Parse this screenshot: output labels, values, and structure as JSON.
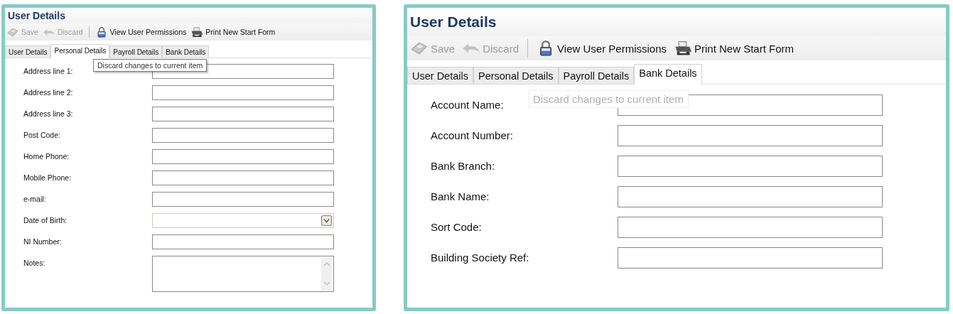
{
  "panels": [
    {
      "title": "User Details",
      "toolbar": [
        {
          "kind": "save",
          "label": "Save",
          "disabled": true
        },
        {
          "kind": "discard",
          "label": "Discard",
          "disabled": true
        },
        {
          "kind": "separator"
        },
        {
          "kind": "permissions",
          "label": "View User Permissions",
          "disabled": false
        },
        {
          "kind": "print",
          "label": "Print New Start Form",
          "disabled": false
        }
      ],
      "tabs": [
        {
          "label": "User Details",
          "selected": false
        },
        {
          "label": "Personal Details",
          "selected": true
        },
        {
          "label": "Payroll Details",
          "selected": false
        },
        {
          "label": "Bank Details",
          "selected": false
        }
      ],
      "tooltip": {
        "text": "Discard changes to current item",
        "faded": false
      },
      "fields": [
        {
          "label": "Address line 1:",
          "kind": "text"
        },
        {
          "label": "Address line 2:",
          "kind": "text"
        },
        {
          "label": "Address line 3:",
          "kind": "text"
        },
        {
          "label": "Post Code:",
          "kind": "text"
        },
        {
          "label": "Home Phone:",
          "kind": "text"
        },
        {
          "label": "Mobile Phone:",
          "kind": "text"
        },
        {
          "label": "e-mail:",
          "kind": "text"
        },
        {
          "label": "Date of Birth:",
          "kind": "date"
        },
        {
          "label": "NI Number:",
          "kind": "text"
        },
        {
          "label": "Notes:",
          "kind": "textarea"
        }
      ]
    },
    {
      "title": "User Details",
      "toolbar": [
        {
          "kind": "save",
          "label": "Save",
          "disabled": true
        },
        {
          "kind": "discard",
          "label": "Discard",
          "disabled": true
        },
        {
          "kind": "separator"
        },
        {
          "kind": "permissions",
          "label": "View User Permissions",
          "disabled": false
        },
        {
          "kind": "print",
          "label": "Print New Start Form",
          "disabled": false
        }
      ],
      "tabs": [
        {
          "label": "User Details",
          "selected": false
        },
        {
          "label": "Personal Details",
          "selected": false
        },
        {
          "label": "Payroll Details",
          "selected": false
        },
        {
          "label": "Bank Details",
          "selected": true
        }
      ],
      "tooltip": {
        "text": "Discard changes to current item",
        "faded": true
      },
      "fields": [
        {
          "label": "Account Name:",
          "kind": "text"
        },
        {
          "label": "Account Number:",
          "kind": "text"
        },
        {
          "label": "Bank Branch:",
          "kind": "text"
        },
        {
          "label": "Bank Name:",
          "kind": "text"
        },
        {
          "label": "Sort Code:",
          "kind": "text"
        },
        {
          "label": "Building Society Ref:",
          "kind": "text"
        }
      ]
    }
  ]
}
